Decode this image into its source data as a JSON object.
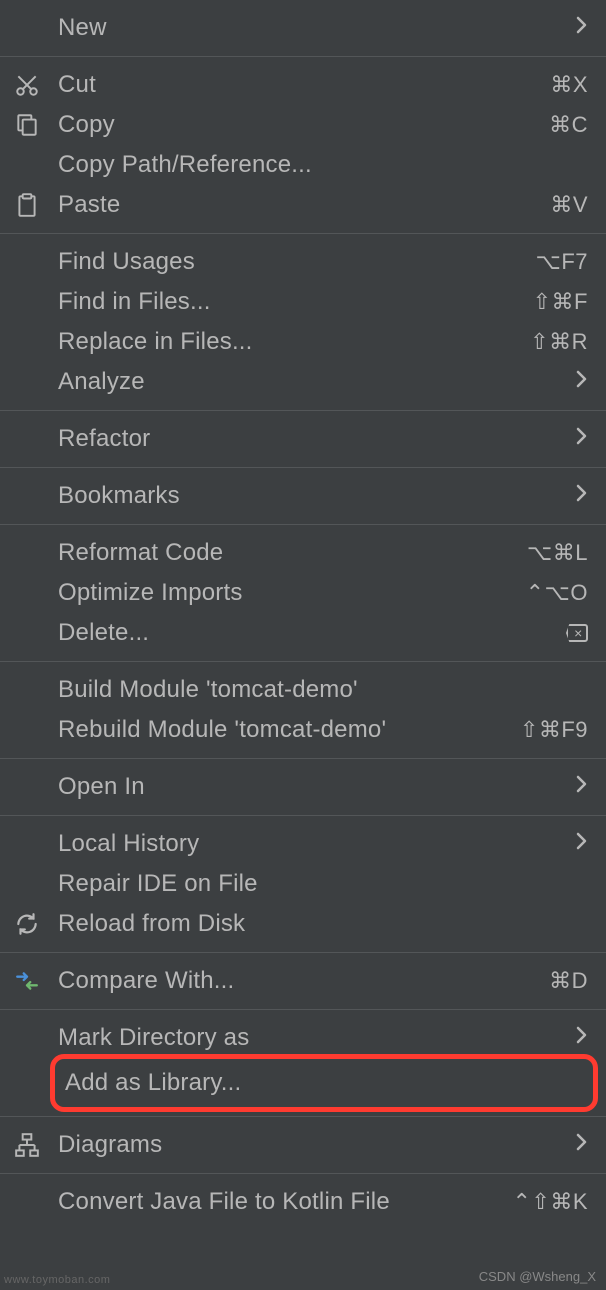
{
  "menu": {
    "new": {
      "label": "New",
      "submenu": true
    },
    "cut": {
      "label": "Cut",
      "shortcut": "⌘X"
    },
    "copy": {
      "label": "Copy",
      "shortcut": "⌘C"
    },
    "copyPath": {
      "label": "Copy Path/Reference..."
    },
    "paste": {
      "label": "Paste",
      "shortcut": "⌘V"
    },
    "findUsages": {
      "label": "Find Usages",
      "shortcut": "⌥F7"
    },
    "findInFiles": {
      "label": "Find in Files...",
      "shortcut": "⇧⌘F"
    },
    "replaceInFiles": {
      "label": "Replace in Files...",
      "shortcut": "⇧⌘R"
    },
    "analyze": {
      "label": "Analyze",
      "submenu": true
    },
    "refactor": {
      "label": "Refactor",
      "submenu": true
    },
    "bookmarks": {
      "label": "Bookmarks",
      "submenu": true
    },
    "reformatCode": {
      "label": "Reformat Code",
      "shortcut": "⌥⌘L"
    },
    "optimizeImports": {
      "label": "Optimize Imports",
      "shortcut": "⌃⌥O"
    },
    "delete": {
      "label": "Delete...",
      "shortcut_icon": "delete"
    },
    "buildModule": {
      "label": "Build Module 'tomcat-demo'"
    },
    "rebuildModule": {
      "label": "Rebuild Module 'tomcat-demo'",
      "shortcut": "⇧⌘F9"
    },
    "openIn": {
      "label": "Open In",
      "submenu": true
    },
    "localHistory": {
      "label": "Local History",
      "submenu": true
    },
    "repairIde": {
      "label": "Repair IDE on File"
    },
    "reloadDisk": {
      "label": "Reload from Disk"
    },
    "compareWith": {
      "label": "Compare With...",
      "shortcut": "⌘D"
    },
    "markDirectory": {
      "label": "Mark Directory as",
      "submenu": true
    },
    "addAsLibrary": {
      "label": "Add as Library..."
    },
    "diagrams": {
      "label": "Diagrams",
      "submenu": true
    },
    "convertKotlin": {
      "label": "Convert Java File to Kotlin File",
      "shortcut": "⌃⇧⌘K"
    }
  },
  "watermark": "CSDN @Wsheng_X",
  "watermark_left": "www.toymoban.com"
}
